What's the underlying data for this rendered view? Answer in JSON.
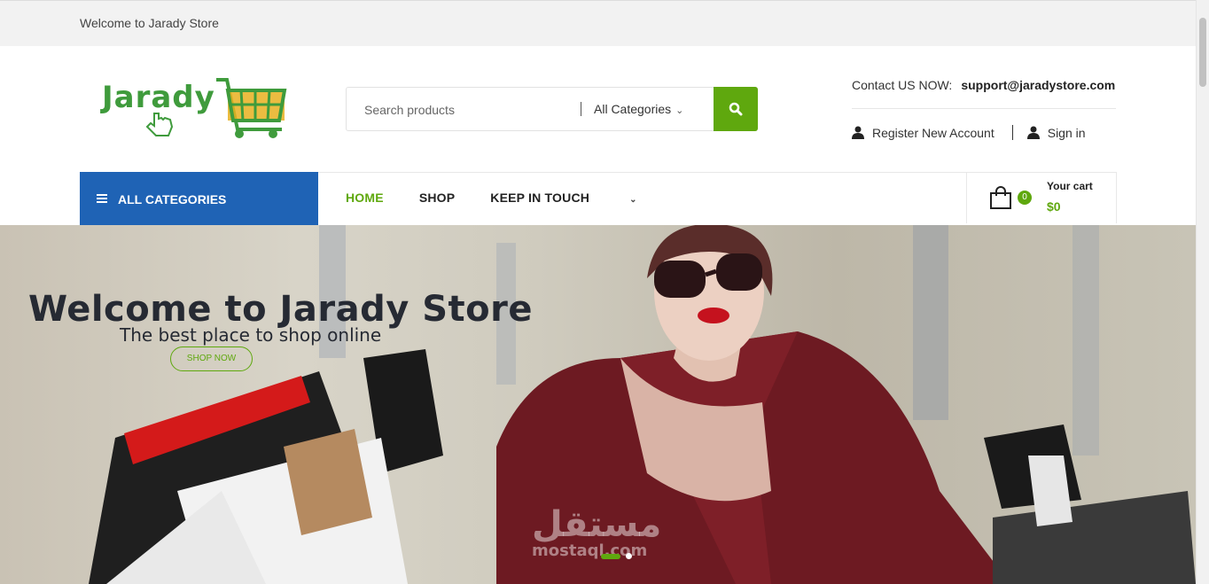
{
  "topbar": {
    "welcome": "Welcome to Jarady Store"
  },
  "logo": {
    "text": "Jarady"
  },
  "search": {
    "placeholder": "Search products",
    "category": "All Categories"
  },
  "contact": {
    "label": "Contact US NOW:",
    "email": "support@jaradystore.com"
  },
  "account": {
    "register": "Register New Account",
    "signin": "Sign in"
  },
  "nav": {
    "all_categories": "ALL CATEGORIES",
    "items": [
      {
        "label": "HOME"
      },
      {
        "label": "SHOP"
      },
      {
        "label": "KEEP IN TOUCH"
      }
    ]
  },
  "cart": {
    "count": "0",
    "label": "Your cart",
    "total": "$0"
  },
  "hero": {
    "title": "Welcome to Jarady Store",
    "subtitle": "The best place to shop online",
    "cta": "SHOP NOW",
    "watermark_ar": "مستقل",
    "watermark_lat": "mostaql.com"
  },
  "colors": {
    "green": "#5fa80e",
    "blue": "#1f63b5",
    "logo_green": "#3f9b3c"
  }
}
